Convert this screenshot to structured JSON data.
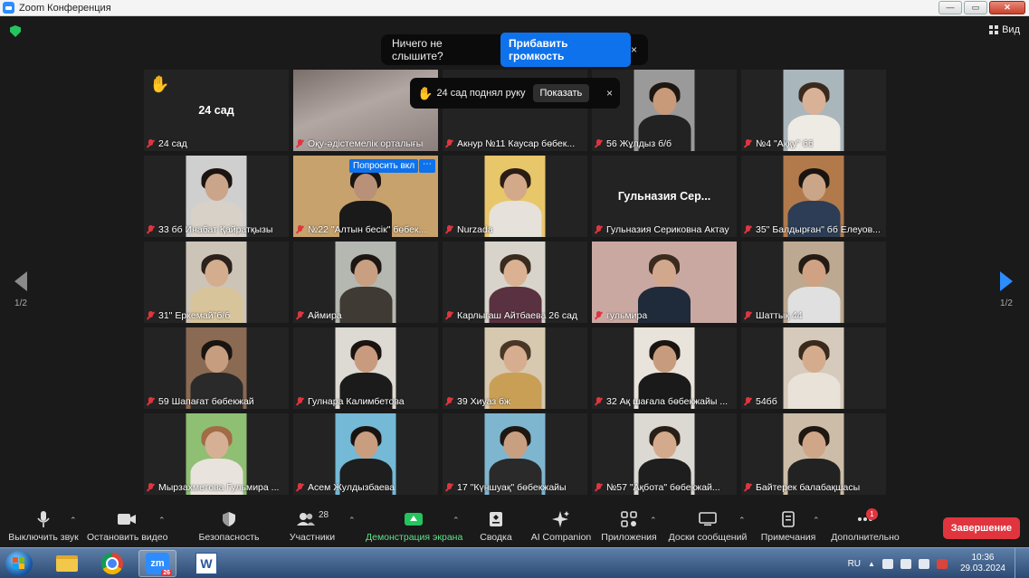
{
  "window": {
    "title": "Zoom Конференция",
    "btn_min": "—",
    "btn_max": "▭",
    "btn_close": "✕"
  },
  "top": {
    "view_label": "Вид",
    "audio_toast": {
      "text": "Ничего не слышите?",
      "button": "Прибавить громкость",
      "close": "×"
    },
    "hand_toast": {
      "icon": "✋",
      "text": "24 сад поднял руку",
      "button": "Показать",
      "close": "×"
    }
  },
  "pagination": {
    "left_label": "1/2",
    "right_label": "1/2"
  },
  "participants": [
    {
      "name": "24 сад",
      "center_name": "24 сад",
      "type": "name",
      "hand": "✋"
    },
    {
      "name": "Оқу-әдістемелік орталығы",
      "type": "blur",
      "active": true
    },
    {
      "name": "Акнур №11 Каусар бөбек...",
      "type": "empty"
    },
    {
      "name": "56 Жұлдыз б/б",
      "type": "photo",
      "skin": "#c89a7a",
      "hair": "#1e1611",
      "cloth": "#222"
    },
    {
      "name": "№4 \"Аққу\" бб",
      "type": "photo",
      "skin": "#d8b196",
      "hair": "#3a2a1d",
      "cloth": "#eeeae4",
      "bg": "#a9b6bb"
    },
    {
      "name": "33 бб Инабат Қайратқызы",
      "type": "photo",
      "skin": "#caa58a",
      "hair": "#1b1411",
      "cloth": "#d7d1c8",
      "bg": "#cfcfcf"
    },
    {
      "name": "№22 \"Алтын бесік\" бөбек...",
      "type": "photo-wide",
      "skin": "#b99179",
      "hair": "#1b1411",
      "cloth": "#1a1a1a",
      "bg": "#c7a26d",
      "ask": "Попросить вкл",
      "more": "⋯"
    },
    {
      "name": "Nurzada",
      "type": "photo",
      "skin": "#d3aa89",
      "hair": "#2a1d14",
      "cloth": "#e6e1da",
      "bg": "#e8c66a"
    },
    {
      "name": "Гульназия Сериковна Актау",
      "center_name": "Гульназия   Сер...",
      "type": "name"
    },
    {
      "name": "35\" Балдырған\" бб Елеуов...",
      "type": "photo",
      "skin": "#cba587",
      "hair": "#1a1410",
      "cloth": "#2c3d55",
      "bg": "#b27a4b"
    },
    {
      "name": "31\" Еркемай\"б/б",
      "type": "photo",
      "skin": "#d3ad8e",
      "hair": "#2a211c",
      "cloth": "#d8c49a",
      "bg": "#cdc4b8"
    },
    {
      "name": "Аймира",
      "type": "photo",
      "skin": "#c99f82",
      "hair": "#1d1612",
      "cloth": "#3f3a34",
      "bg": "#b5b7b1"
    },
    {
      "name": "Карлыгаш Айтбаева 26 сад",
      "type": "photo",
      "skin": "#dab293",
      "hair": "#3a2b1f",
      "cloth": "#5a3140",
      "bg": "#d8d4cb"
    },
    {
      "name": "гульмира",
      "type": "photo-wide",
      "skin": "#d2a88d",
      "hair": "#3b2b1f",
      "cloth": "#1f2a3a",
      "bg": "#caa8a2"
    },
    {
      "name": "Шаттық 44",
      "type": "photo",
      "skin": "#cfa283",
      "hair": "#241b15",
      "cloth": "#e0e0e0",
      "bg": "#bda891"
    },
    {
      "name": "59 Шапағат бөбекжай",
      "type": "photo",
      "skin": "#c79d80",
      "hair": "#1a1410",
      "cloth": "#2a2a2a",
      "bg": "#8a6a52"
    },
    {
      "name": "Гулнара Калимбетова",
      "type": "photo",
      "skin": "#c89b7f",
      "hair": "#1a1410",
      "cloth": "#1b1b1b",
      "bg": "#ddd9d3"
    },
    {
      "name": "39 Хиуаз бж",
      "type": "photo",
      "skin": "#d6ad8f",
      "hair": "#4a3626",
      "cloth": "#c99f56",
      "bg": "#d7c9b0"
    },
    {
      "name": "32 Ақ шағала бөбекжайы ...",
      "type": "photo",
      "skin": "#c79c7e",
      "hair": "#1a1410",
      "cloth": "#1a1a1a",
      "bg": "#e8e3db"
    },
    {
      "name": "54бб",
      "type": "photo",
      "skin": "#d4ab8c",
      "hair": "#3a2a1d",
      "cloth": "#e8e2d8",
      "bg": "#d5cabb"
    },
    {
      "name": "Мырзахметова Гульмира ...",
      "type": "photo",
      "skin": "#d6b095",
      "hair": "#a16c46",
      "cloth": "#e8e3dd",
      "bg": "#8fbf72"
    },
    {
      "name": "Асем Жулдызбаева",
      "type": "photo",
      "skin": "#c99d7f",
      "hair": "#1a1410",
      "cloth": "#1e1e1e",
      "bg": "#74b9d6"
    },
    {
      "name": "17 \"Күншуақ\" бөбекжайы",
      "type": "photo",
      "skin": "#c99f82",
      "hair": "#1f1712",
      "cloth": "#2a2a2a",
      "bg": "#7fb6cf"
    },
    {
      "name": "№57 \"Ақбота\" бөбекжай...",
      "type": "photo",
      "skin": "#d4aa8c",
      "hair": "#2a1f16",
      "cloth": "#1e1e1e",
      "bg": "#dcd8d2"
    },
    {
      "name": "Байтерек балабақшасы",
      "type": "photo",
      "skin": "#cfa688",
      "hair": "#1f1712",
      "cloth": "#222",
      "bg": "#cdbda8"
    }
  ],
  "toolbar": {
    "mute": "Выключить звук",
    "video": "Остановить видео",
    "security": "Безопасность",
    "participants": "Участники",
    "participants_count": "28",
    "share": "Демонстрация экрана",
    "summary": "Сводка",
    "ai": "AI Companion",
    "apps": "Приложения",
    "whiteboards": "Доски сообщений",
    "notes": "Примечания",
    "more": "Дополнительно",
    "more_badge": "1",
    "end": "Завершение",
    "caret": "⌃"
  },
  "taskbar": {
    "zoom_text": "zm",
    "zoom_badge": "26",
    "word_text": "W",
    "lang": "RU",
    "tray_arrow": "▲",
    "time": "10:36",
    "date": "29.03.2024"
  },
  "colors": {
    "accent": "#0e72ed",
    "active_speaker": "#b6e234",
    "muted": "#e0353f",
    "share_green": "#23c55e"
  }
}
